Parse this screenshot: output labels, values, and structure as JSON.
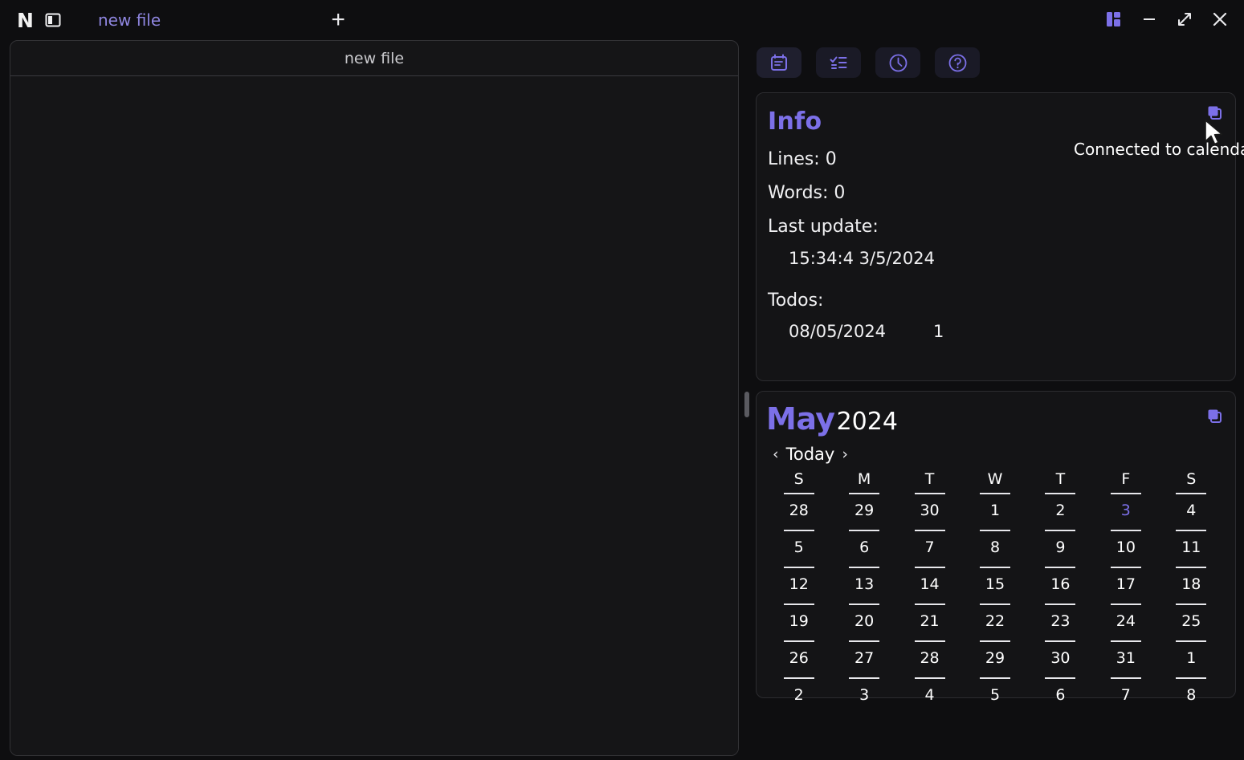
{
  "app": {
    "logo_letter": "N",
    "sidebar_toggle_icon": "sidebar-toggle-icon"
  },
  "tabs": [
    {
      "label": "new file"
    }
  ],
  "tab_add_label": "+",
  "window_controls": {
    "layout_label": "layout-grid-icon",
    "minimize_label": "minimize-icon",
    "maximize_label": "maximize-icon",
    "close_label": "close-icon"
  },
  "editor": {
    "title": "new file",
    "content": ""
  },
  "toolbar": {
    "buttons": [
      {
        "name": "calendar-icon",
        "label": "Calendar",
        "active": true
      },
      {
        "name": "todo-list-icon",
        "label": "Todos",
        "active": false
      },
      {
        "name": "clock-icon",
        "label": "Clock",
        "active": false
      },
      {
        "name": "help-icon",
        "label": "Help",
        "active": false
      }
    ]
  },
  "info": {
    "title": "Info",
    "lines": "Lines: 0",
    "words": "Words: 0",
    "last_update_label": "Last update:",
    "last_update_value": "15:34:4  3/5/2024",
    "todos_label": "Todos:",
    "todos": [
      {
        "date": "08/05/2024",
        "count": "1"
      }
    ],
    "copy_icon": "duplicate-icon"
  },
  "tooltip": {
    "text": "Connected to calendar"
  },
  "calendar": {
    "month": "May",
    "year": "2024",
    "prev_label": "‹",
    "today_label": "Today",
    "next_label": "›",
    "copy_icon": "duplicate-icon",
    "weekdays": [
      "S",
      "M",
      "T",
      "W",
      "T",
      "F",
      "S"
    ],
    "weeks": [
      [
        {
          "d": "28",
          "today": false
        },
        {
          "d": "29",
          "today": false
        },
        {
          "d": "30",
          "today": false
        },
        {
          "d": "1",
          "today": false
        },
        {
          "d": "2",
          "today": false
        },
        {
          "d": "3",
          "today": true
        },
        {
          "d": "4",
          "today": false
        }
      ],
      [
        {
          "d": "5",
          "today": false
        },
        {
          "d": "6",
          "today": false
        },
        {
          "d": "7",
          "today": false
        },
        {
          "d": "8",
          "today": false
        },
        {
          "d": "9",
          "today": false
        },
        {
          "d": "10",
          "today": false
        },
        {
          "d": "11",
          "today": false
        }
      ],
      [
        {
          "d": "12",
          "today": false
        },
        {
          "d": "13",
          "today": false
        },
        {
          "d": "14",
          "today": false
        },
        {
          "d": "15",
          "today": false
        },
        {
          "d": "16",
          "today": false
        },
        {
          "d": "17",
          "today": false
        },
        {
          "d": "18",
          "today": false
        }
      ],
      [
        {
          "d": "19",
          "today": false
        },
        {
          "d": "20",
          "today": false
        },
        {
          "d": "21",
          "today": false
        },
        {
          "d": "22",
          "today": false
        },
        {
          "d": "23",
          "today": false
        },
        {
          "d": "24",
          "today": false
        },
        {
          "d": "25",
          "today": false
        }
      ],
      [
        {
          "d": "26",
          "today": false
        },
        {
          "d": "27",
          "today": false
        },
        {
          "d": "28",
          "today": false
        },
        {
          "d": "29",
          "today": false
        },
        {
          "d": "30",
          "today": false
        },
        {
          "d": "31",
          "today": false
        },
        {
          "d": "1",
          "today": false
        }
      ],
      [
        {
          "d": "2",
          "today": false
        },
        {
          "d": "3",
          "today": false
        },
        {
          "d": "4",
          "today": false
        },
        {
          "d": "5",
          "today": false
        },
        {
          "d": "6",
          "today": false
        },
        {
          "d": "7",
          "today": false
        },
        {
          "d": "8",
          "today": false
        }
      ]
    ]
  },
  "colors": {
    "accent": "#7c70e8",
    "tab_text": "#8f86e0",
    "background": "#0e0e10",
    "panel": "#141416",
    "text": "#ffffff"
  }
}
